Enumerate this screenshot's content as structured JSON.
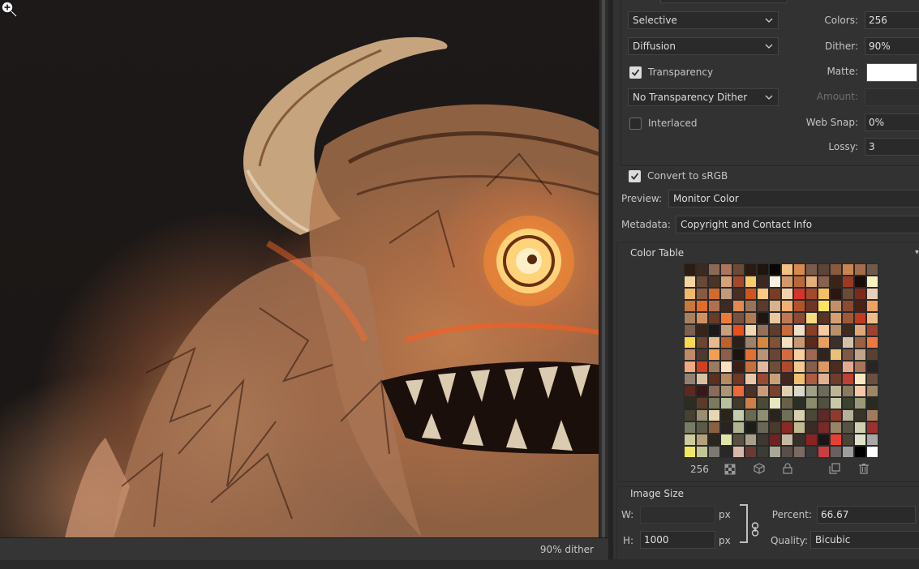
{
  "status": {
    "dither_text": "90% dither"
  },
  "optimize": {
    "reduction_select": "Selective",
    "dither_select": "Diffusion",
    "transparency_label": "Transparency",
    "transparency_checked": true,
    "transparency_dither_select": "No Transparency Dither",
    "interlaced_label": "Interlaced",
    "interlaced_checked": false,
    "colors_label": "Colors:",
    "colors_value": "256",
    "dither_label": "Dither:",
    "dither_value": "90%",
    "matte_label": "Matte:",
    "matte_color": "#ffffff",
    "amount_label": "Amount:",
    "amount_value": "",
    "websnap_label": "Web Snap:",
    "websnap_value": "0%",
    "lossy_label": "Lossy:",
    "lossy_value": "3"
  },
  "output": {
    "convert_label": "Convert to sRGB",
    "convert_checked": true,
    "preview_label": "Preview:",
    "preview_value": "Monitor Color",
    "metadata_label": "Metadata:",
    "metadata_value": "Copyright and Contact Info"
  },
  "color_table": {
    "title": "Color Table",
    "count": "256",
    "swatches": [
      "#2b1c14",
      "#3c2a20",
      "#8a6a52",
      "#b0745a",
      "#6b4a38",
      "#2a1a12",
      "#1e1410",
      "#0a0606",
      "#f1c280",
      "#d88a4c",
      "#7a5c4a",
      "#5e4436",
      "#8a5a3c",
      "#c9854e",
      "#a66b48",
      "#705a4d",
      "#f5d4a0",
      "#6a4838",
      "#4a3428",
      "#d7a276",
      "#a24a2c",
      "#f7cb70",
      "#3c2820",
      "#f9f2e3",
      "#d29a6a",
      "#b66a3a",
      "#e2b07a",
      "#87624c",
      "#3a2418",
      "#9a3a22",
      "#1a0e0a",
      "#fbf0c0",
      "#f0b868",
      "#8a5a40",
      "#d26a2c",
      "#c09a7c",
      "#4a2e22",
      "#d0541e",
      "#ffc780",
      "#7a3c26",
      "#f2d2a8",
      "#d4352a",
      "#a4482e",
      "#f6c060",
      "#2a1612",
      "#6c4a38",
      "#7e2a1a",
      "#e8d0b8",
      "#c8783a",
      "#e66a28",
      "#b07050",
      "#3e2a20",
      "#e08a50",
      "#9a7256",
      "#5a3a2c",
      "#d8b28c",
      "#f1b070",
      "#b3532a",
      "#6e3626",
      "#fde460",
      "#c0906a",
      "#8c4a30",
      "#4a2018",
      "#f2a060",
      "#a88060",
      "#d09060",
      "#6a3a28",
      "#ef7a38",
      "#7a5040",
      "#b27a52",
      "#201610",
      "#e8c8a0",
      "#c07850",
      "#8a4a34",
      "#f5dc80",
      "#5a3424",
      "#d4a070",
      "#a05838",
      "#c23a20",
      "#f0bc88",
      "#7a6050",
      "#3a2418",
      "#1a1818",
      "#c8a080",
      "#e85020",
      "#f0d8b0",
      "#94705a",
      "#5c3e30",
      "#cc6a3a",
      "#eee0c8",
      "#8a3e26",
      "#f8c8a0",
      "#b8906a",
      "#402a22",
      "#e0a878",
      "#a24030",
      "#fcd850",
      "#6c4430",
      "#e8b890",
      "#c06030",
      "#2e1e18",
      "#a08068",
      "#d8883c",
      "#805238",
      "#f4e0c0",
      "#c89870",
      "#5a2a1a",
      "#e8a060",
      "#3c3028",
      "#d4c0a8",
      "#9a6040",
      "#f07840",
      "#bd8a6a",
      "#4e3a30",
      "#f0a050",
      "#8c6048",
      "#1c1210",
      "#e47030",
      "#b89478",
      "#6a4434",
      "#d86a40",
      "#f8d0a0",
      "#a06850",
      "#302420",
      "#e8c078",
      "#7e5a46",
      "#c4a488",
      "#5a4030",
      "#f0a880",
      "#d04020",
      "#9a7a60",
      "#f8e0c0",
      "#3e1e14",
      "#c8703c",
      "#e0b8a0",
      "#6e4e3a",
      "#b04a2a",
      "#f4c890",
      "#84604c",
      "#dc9860",
      "#4c2c20",
      "#e4a890",
      "#a87458",
      "#2a2424",
      "#948070",
      "#d8c0a0",
      "#5a3020",
      "#b88a60",
      "#703828",
      "#e8c8a8",
      "#9a4a30",
      "#c8a078",
      "#402820",
      "#f0c070",
      "#ac5c40",
      "#e0b090",
      "#703c2c",
      "#c04030",
      "#f8e8c0",
      "#6a5040",
      "#5a2a20",
      "#381818",
      "#8a6a58",
      "#ac9478",
      "#ec6a3a",
      "#4a3228",
      "#c89c7c",
      "#7c4030",
      "#e0d0b0",
      "#dcd8c8",
      "#a0a088",
      "#6c6a58",
      "#c0b498",
      "#8a7a60",
      "#f4c8a8",
      "#9c8868",
      "#2c2c20",
      "#5c3a28",
      "#7a7a60",
      "#b8c0a0",
      "#3e3a2c",
      "#cc8044",
      "#4a4a38",
      "#e8e8c0",
      "#6a6048",
      "#2a3024",
      "#8c8c6c",
      "#50503e",
      "#c8c8a8",
      "#3a4230",
      "#9a9a7a",
      "#2a2a22",
      "#484030",
      "#9a8e70",
      "#e8d8b0",
      "#2c2418",
      "#c4ccb0",
      "#6a6a50",
      "#8e8e70",
      "#2a241c",
      "#707058",
      "#d8d0b0",
      "#4c4838",
      "#5e2a28",
      "#8e3a2e",
      "#b8b098",
      "#3a3426",
      "#a07c5c",
      "#787c64",
      "#5c5a48",
      "#8a6040",
      "#2a2220",
      "#b0b490",
      "#1e1e18",
      "#6a6658",
      "#4a3a2c",
      "#8a2a24",
      "#c0b890",
      "#3a2a28",
      "#7a2828",
      "#9a8468",
      "#585444",
      "#d0d0b0",
      "#a03030",
      "#cccc9a",
      "#b4a07c",
      "#2a261e",
      "#e0e4a8",
      "#5a5040",
      "#a8a088",
      "#3e3830",
      "#6e2222",
      "#c4b8a0",
      "#383028",
      "#8a2422",
      "#1a1616",
      "#e84030",
      "#4a4438",
      "#e0e0c8",
      "#a8a8a8",
      "#f0e860",
      "#c4c498",
      "#7a7a70",
      "#2a2826",
      "#d8b8a8",
      "#6a3a32",
      "#3c3c36",
      "#a8a898",
      "#5a4e4a",
      "#7a6a62",
      "#383838",
      "#c84040",
      "#6a6060",
      "#9e9e9e",
      "#000000",
      "#ffffff"
    ]
  },
  "image_size": {
    "title": "Image Size",
    "w_label": "W:",
    "w_value": "",
    "h_label": "H:",
    "h_value": "1000",
    "unit": "px",
    "percent_label": "Percent:",
    "percent_value": "66.67",
    "quality_label": "Quality:",
    "quality_value": "Bicubic"
  },
  "icons": [
    "zoom-in-icon",
    "chevron-down-icon",
    "checkmark-icon",
    "link-icon",
    "web-safe-icon",
    "cube-icon",
    "lock-icon",
    "new-color-icon",
    "trash-icon"
  ]
}
